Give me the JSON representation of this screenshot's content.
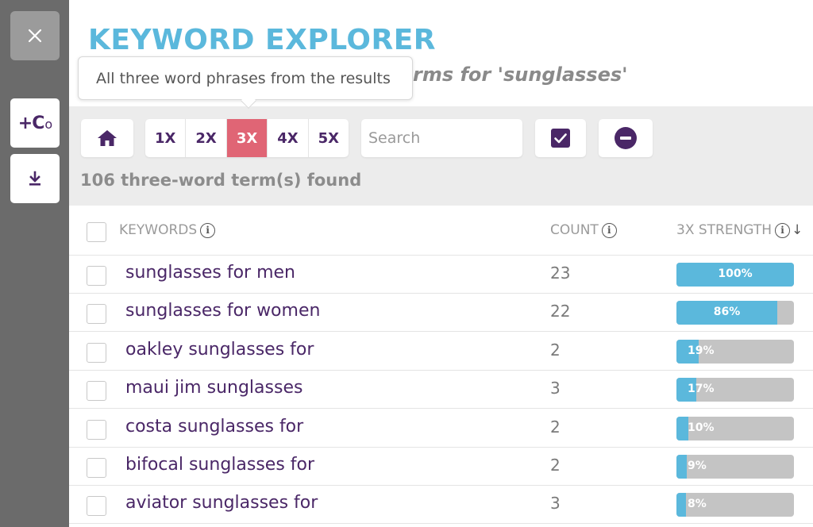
{
  "rail": {
    "close_icon": "close-icon",
    "add_co_label": "+C",
    "add_co_suffix": "o",
    "download_icon": "download-icon"
  },
  "header": {
    "title": "KEYWORD EXPLORER",
    "subtitle_visible": "rms for 'sunglasses'",
    "tooltip": "All three word phrases from the results"
  },
  "toolbar": {
    "home_icon": "home-icon",
    "word_counts": [
      "1X",
      "2X",
      "3X",
      "4X",
      "5X"
    ],
    "active_word_count": "3X",
    "search_placeholder": "Search",
    "search_value": "",
    "check_icon": "checkbox-checked-icon",
    "minus_icon": "minus-circle-icon",
    "found_text": "106 three-word term(s) found"
  },
  "table": {
    "headers": {
      "keywords": "KEYWORDS",
      "count": "COUNT",
      "strength": "3X STRENGTH"
    },
    "rows": [
      {
        "keyword": "sunglasses for men",
        "count": "23",
        "strength": 100,
        "strength_label": "100%"
      },
      {
        "keyword": "sunglasses for women",
        "count": "22",
        "strength": 86,
        "strength_label": "86%"
      },
      {
        "keyword": "oakley sunglasses for",
        "count": "2",
        "strength": 19,
        "strength_label": "19%"
      },
      {
        "keyword": "maui jim sunglasses",
        "count": "3",
        "strength": 17,
        "strength_label": "17%"
      },
      {
        "keyword": "costa sunglasses for",
        "count": "2",
        "strength": 10,
        "strength_label": "10%"
      },
      {
        "keyword": "bifocal sunglasses for",
        "count": "2",
        "strength": 9,
        "strength_label": "9%"
      },
      {
        "keyword": "aviator sunglasses for",
        "count": "3",
        "strength": 8,
        "strength_label": "8%"
      }
    ]
  },
  "colors": {
    "title_blue": "#5bb8dc",
    "purple": "#4a2767",
    "active_pink": "#e06575",
    "bar_fill": "#5bb8dc",
    "bar_track": "#c4c4c4"
  }
}
